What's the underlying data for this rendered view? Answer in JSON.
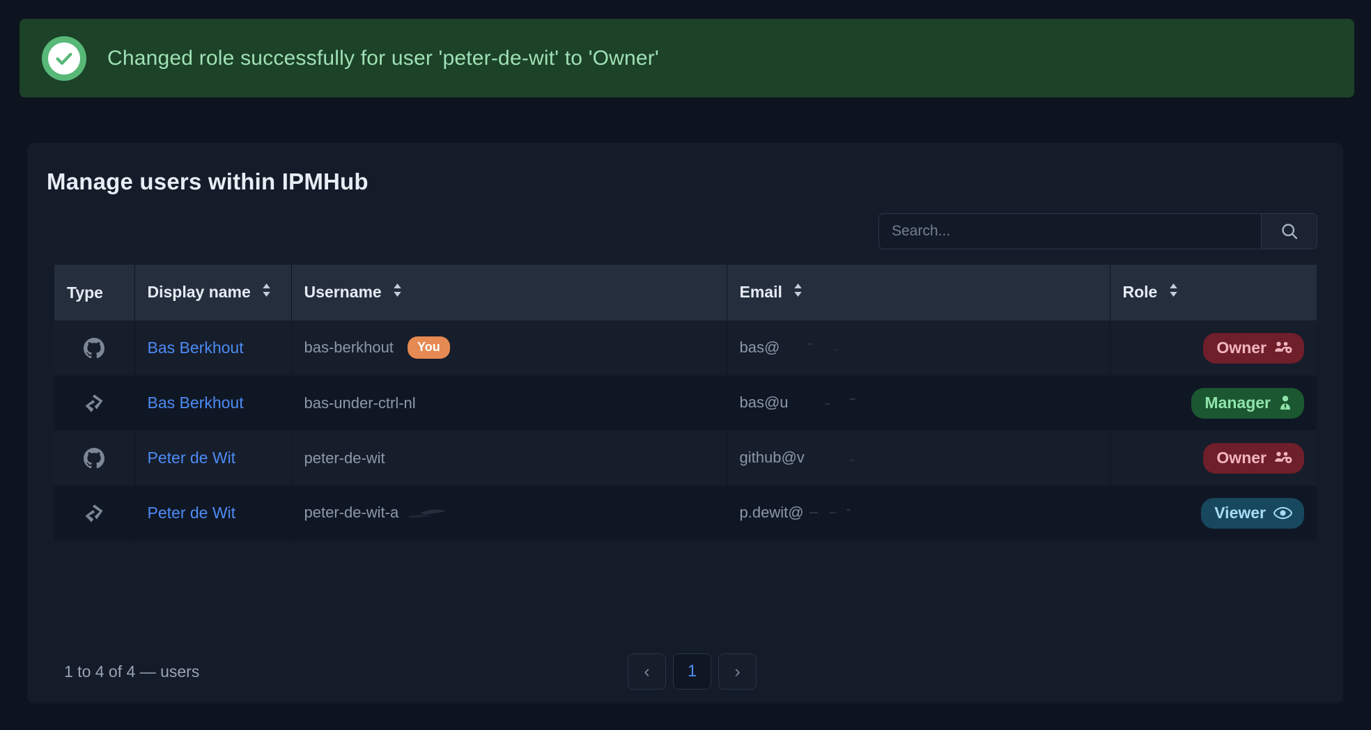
{
  "banner": {
    "icon": "check-circle-icon",
    "message": "Changed role successfully for user 'peter-de-wit' to 'Owner'",
    "bg_color": "#1c4228",
    "text_color": "#9fe0b4",
    "accent_color": "#58b877"
  },
  "card": {
    "title": "Manage users within IPMHub"
  },
  "search": {
    "value": "",
    "placeholder": "Search...",
    "button_icon": "search-icon"
  },
  "table": {
    "columns": [
      {
        "key": "type",
        "label": "Type",
        "sortable": false
      },
      {
        "key": "display",
        "label": "Display name",
        "sortable": true
      },
      {
        "key": "user",
        "label": "Username",
        "sortable": true
      },
      {
        "key": "email",
        "label": "Email",
        "sortable": true
      },
      {
        "key": "role",
        "label": "Role",
        "sortable": true
      }
    ],
    "rows": [
      {
        "type_icon": "github-icon",
        "display_name": "Bas Berkhout",
        "username": "bas-berkhout",
        "badge": "You",
        "email": "bas@",
        "email_redacted": true,
        "role": "Owner",
        "role_icon": "users-gear-icon",
        "role_style": "owner"
      },
      {
        "type_icon": "azure-devops-icon",
        "display_name": "Bas Berkhout",
        "username": "bas-under-ctrl-nl",
        "badge": null,
        "email": "bas@u",
        "email_redacted": true,
        "role": "Manager",
        "role_icon": "user-tie-icon",
        "role_style": "manager"
      },
      {
        "type_icon": "github-icon",
        "display_name": "Peter de Wit",
        "username": "peter-de-wit",
        "badge": null,
        "email": "github@v",
        "email_redacted": true,
        "role": "Owner",
        "role_icon": "users-gear-icon",
        "role_style": "owner"
      },
      {
        "type_icon": "azure-devops-icon",
        "display_name": "Peter de Wit",
        "username": "peter-de-wit-a",
        "username_redacted": true,
        "badge": null,
        "email": "p.dewit@",
        "email_redacted": true,
        "role": "Viewer",
        "role_icon": "eye-icon",
        "role_style": "viewer"
      }
    ]
  },
  "footer": {
    "count_text": "1 to 4 of 4 — users",
    "prev_label": "‹",
    "page_label": "1",
    "next_label": "›"
  },
  "colors": {
    "page_bg": "#0d131f",
    "card_bg": "#141b29",
    "header_bg": "#242e3d",
    "row_odd": "#161d2b",
    "row_even": "#101724",
    "link": "#4d8bf5",
    "muted": "#8d98a9",
    "owner": "#6e1f2a",
    "manager": "#1b5730",
    "viewer": "#17485e",
    "you_badge": "#e58a52"
  }
}
